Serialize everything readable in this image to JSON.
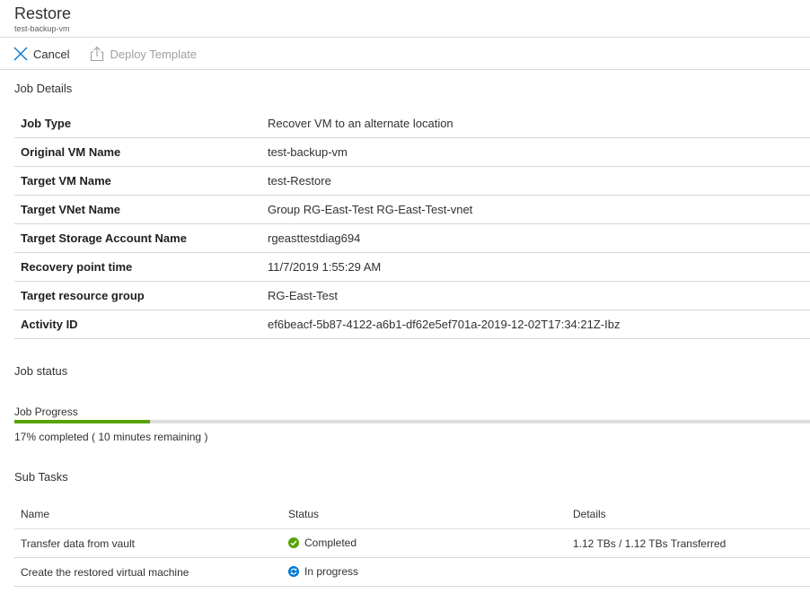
{
  "header": {
    "title": "Restore",
    "subtitle": "test-backup-vm"
  },
  "commands": {
    "cancel_label": "Cancel",
    "deploy_label": "Deploy Template"
  },
  "job_details": {
    "section_title": "Job Details",
    "rows": [
      {
        "key": "Job Type",
        "value": "Recover VM to an alternate location"
      },
      {
        "key": "Original VM Name",
        "value": "test-backup-vm"
      },
      {
        "key": "Target VM Name",
        "value": "test-Restore"
      },
      {
        "key": "Target VNet Name",
        "value": "Group RG-East-Test RG-East-Test-vnet"
      },
      {
        "key": "Target Storage Account Name",
        "value": "rgeasttestdiag694"
      },
      {
        "key": "Recovery point time",
        "value": "11/7/2019 1:55:29 AM"
      },
      {
        "key": "Target resource group",
        "value": "RG-East-Test"
      },
      {
        "key": "Activity ID",
        "value": "ef6beacf-5b87-4122-a6b1-df62e5ef701a-2019-12-02T17:34:21Z-Ibz"
      }
    ]
  },
  "job_status": {
    "section_title": "Job status",
    "progress_label": "Job Progress",
    "progress_percent": 17,
    "progress_text": "17% completed ( 10 minutes remaining )"
  },
  "sub_tasks": {
    "section_title": "Sub Tasks",
    "columns": [
      "Name",
      "Status",
      "Details"
    ],
    "rows": [
      {
        "name": "Transfer data from vault",
        "status": "Completed",
        "status_icon": "check-circle-icon",
        "details": "1.12 TBs / 1.12 TBs Transferred"
      },
      {
        "name": "Create the restored virtual machine",
        "status": "In progress",
        "status_icon": "sync-icon",
        "details": ""
      }
    ]
  },
  "colors": {
    "progress_fill": "#57a300",
    "progress_track": "#dcdcdc",
    "completed_green": "#57a300",
    "in_progress_blue": "#0078d4",
    "accent": "#0078d4"
  }
}
